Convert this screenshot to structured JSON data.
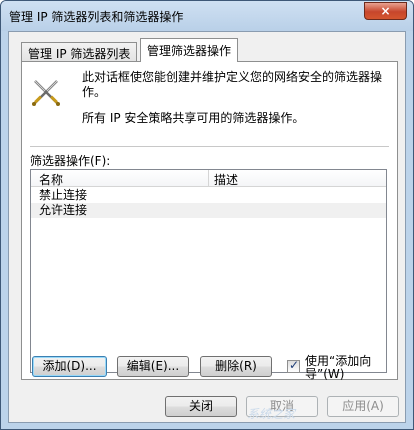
{
  "window": {
    "title": "管理 IP 筛选器列表和筛选器操作",
    "close_label": "×"
  },
  "tabs": [
    {
      "label": "管理 IP 筛选器列表",
      "active": false
    },
    {
      "label": "管理筛选器操作",
      "active": true
    }
  ],
  "panel": {
    "icon": "crossed-swords-icon",
    "description_1": "此对话框使您能创建并维护定义您的网络安全的筛选器操作。",
    "description_2": "所有 IP 安全策略共享可用的筛选器操作。",
    "list_label": "筛选器操作(F):",
    "columns": [
      "名称",
      "描述"
    ],
    "rows": [
      {
        "name": "禁止连接",
        "description": ""
      },
      {
        "name": "允许连接",
        "description": ""
      }
    ]
  },
  "buttons": {
    "add": "添加(D)...",
    "edit": "编辑(E)...",
    "remove": "删除(R)",
    "close": "关闭",
    "cancel": "取消",
    "apply": "应用(A)"
  },
  "wizard_checkbox": {
    "label": "使用“添加向导”(W)",
    "checked": true
  },
  "watermark": "系统之家",
  "colors": {
    "window_frame": "#bcd3ea",
    "close_button": "#c7462c",
    "default_button_border": "#3c7fb1"
  }
}
